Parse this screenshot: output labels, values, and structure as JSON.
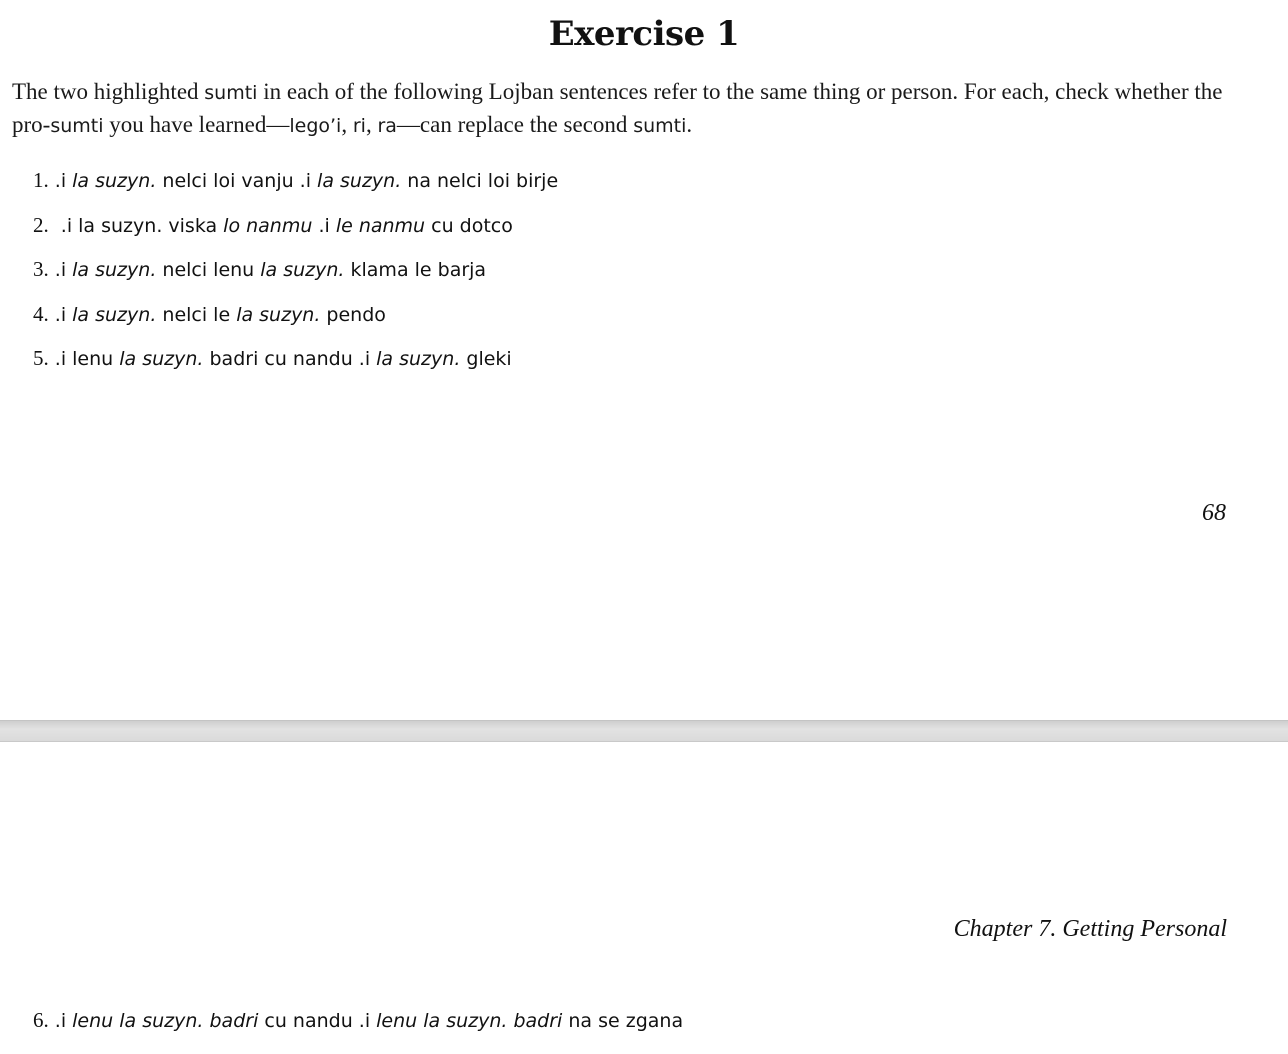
{
  "page1": {
    "title": "Exercise 1",
    "intro": {
      "t1": "The two highlighted ",
      "k1": "sumti",
      "t2": " in each of the following Lojban sentences refer to the same thing or person. For each, check whether the pro-",
      "k2": "sumti",
      "t3": " you have learned—",
      "k3": "lego’i",
      "t4": ", ",
      "k4": "ri",
      "t5": ", ",
      "k5": "ra",
      "t6": "—can replace the second ",
      "k6": "sumti",
      "t7": "."
    },
    "exercises": [
      {
        "num": "1.",
        "parts": [
          ".i ",
          "la suzyn.",
          " nelci loi vanju .i ",
          "la suzyn.",
          " na nelci loi birje"
        ]
      },
      {
        "num": "2.",
        "parts": [
          ".i la suzyn. viska ",
          "lo nanmu",
          " .i ",
          "le nanmu",
          " cu dotco"
        ]
      },
      {
        "num": "3.",
        "parts": [
          ".i ",
          "la suzyn.",
          " nelci lenu ",
          "la suzyn.",
          " klama le barja"
        ]
      },
      {
        "num": "4.",
        "parts": [
          ".i ",
          "la suzyn.",
          " nelci le ",
          "la suzyn.",
          " pendo"
        ]
      },
      {
        "num": "5.",
        "parts": [
          ".i lenu ",
          "la suzyn.",
          " badri cu nandu .i ",
          "la suzyn.",
          " gleki"
        ]
      }
    ],
    "page_number": "68"
  },
  "page2": {
    "running_header": "Chapter 7. Getting Personal",
    "exercises": [
      {
        "num": "6.",
        "parts": [
          ".i ",
          "lenu la suzyn. badri",
          " cu nandu .i ",
          "lenu la suzyn. badri",
          " na se zgana"
        ]
      }
    ]
  }
}
